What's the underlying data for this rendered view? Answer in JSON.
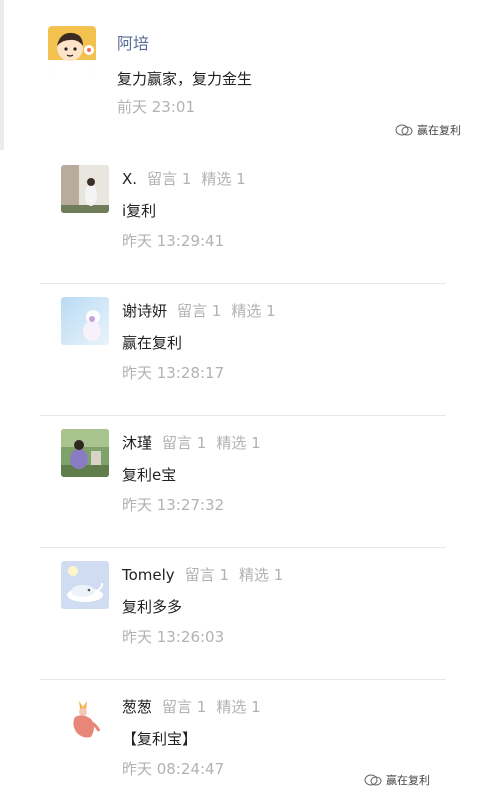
{
  "top_comment": {
    "name": "阿培",
    "text": "复力赢家，复力金生",
    "time": "前天 23:01"
  },
  "watermark": {
    "text": "赢在复利"
  },
  "comments": [
    {
      "name": "X.",
      "stat1": "留言 1",
      "stat2": "精选 1",
      "text": "i复利",
      "time": "昨天 13:29:41"
    },
    {
      "name": "谢诗妍",
      "stat1": "留言 1",
      "stat2": "精选 1",
      "text": "赢在复利",
      "time": "昨天 13:28:17"
    },
    {
      "name": "沐瑾",
      "stat1": "留言 1",
      "stat2": "精选 1",
      "text": "复利e宝",
      "time": "昨天 13:27:32"
    },
    {
      "name": "Tomely",
      "stat1": "留言 1",
      "stat2": "精选 1",
      "text": "复利多多",
      "time": "昨天 13:26:03"
    },
    {
      "name": "葱葱",
      "stat1": "留言 1",
      "stat2": "精选 1",
      "text": "【复利宝】",
      "time": "昨天 08:24:47"
    }
  ]
}
